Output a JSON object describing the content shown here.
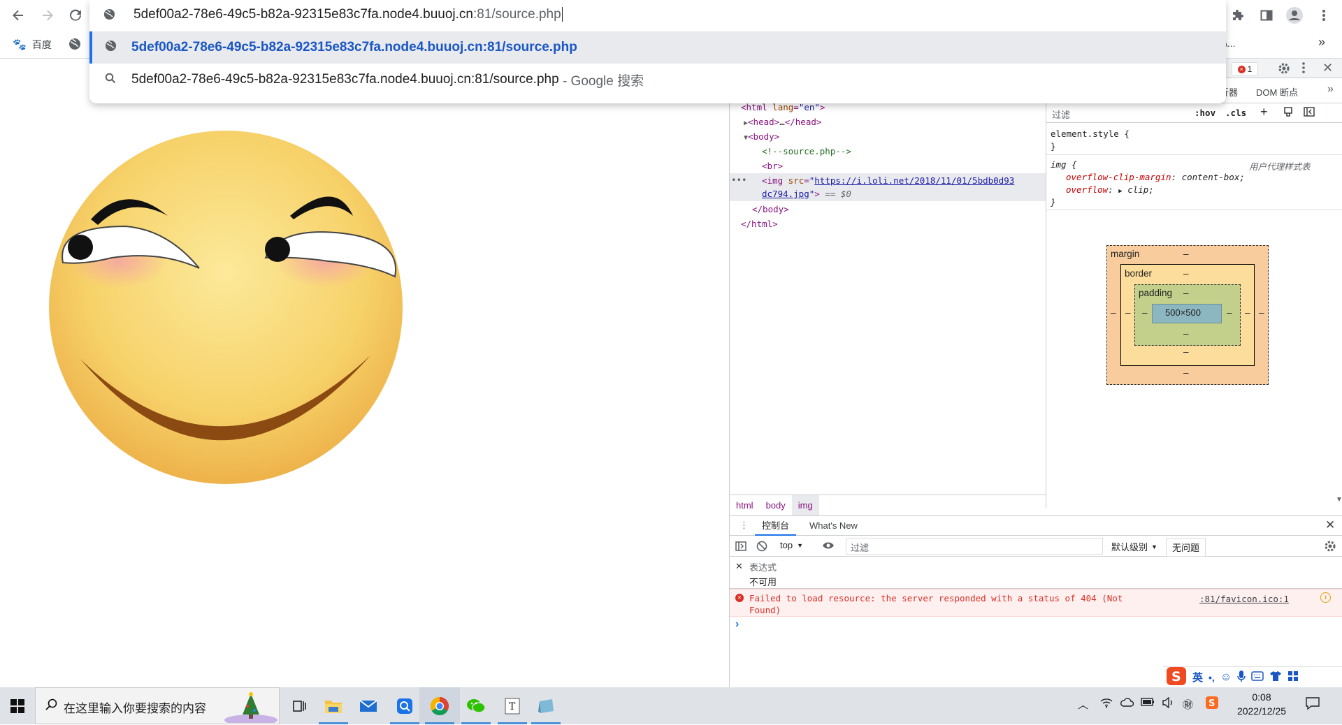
{
  "browser": {
    "url": "5def00a2-78e6-49c5-b82a-92315e83c7fa.node4.buuoj.cn:81/source.php",
    "url_host_part": "5def00a2-78e6-49c5-b82a-92315e83c7fa.node4.buuoj.cn",
    "url_rest_part": ":81/source.php",
    "suggestions": [
      {
        "icon": "globe-icon",
        "text": "5def00a2-78e6-49c5-b82a-92315e83c7fa.node4.buuoj.cn:81/source.php",
        "suffix": ""
      },
      {
        "icon": "search-icon",
        "text": "5def00a2-78e6-49c5-b82a-92315e83c7fa.node4.buuoj.cn:81/source.php",
        "suffix": " - Google 搜索"
      }
    ],
    "bookmarks": [
      {
        "label": "百度"
      }
    ],
    "bookmarks_overflow": "\\...",
    "chevron": "»"
  },
  "devtools": {
    "error_count": "1",
    "tab_partial": "沂器",
    "tab_dom": "DOM 断点",
    "more_tabs": "»",
    "elements": {
      "html_open": "<html lang=\"en\">",
      "lines": [
        {
          "indent": 0,
          "text": "<html lang=\"en\">"
        },
        {
          "indent": 1,
          "text": "▶<head>…</head>"
        },
        {
          "indent": 1,
          "text": "▼<body>"
        },
        {
          "indent": 2,
          "text": "<!--source.php-->"
        },
        {
          "indent": 2,
          "text": "<br>"
        }
      ],
      "img_src_1": "https://i.loli.net/2018/11/01/5bdb0d93",
      "img_src_2": "dc794.jpg",
      "img_eq": "== $0",
      "body_close": "</body>",
      "html_close": "</html>"
    },
    "breadcrumbs": [
      "html",
      "body",
      "img"
    ],
    "styles": {
      "filter_placeholder": "过滤",
      "hov": ":hov",
      "cls": ".cls",
      "element_style": "element.style {",
      "close_brace": "}",
      "img_selector": "img {",
      "ua_label": "用户代理样式表",
      "prop1_name": "overflow-clip-margin",
      "prop1_value": "content-box;",
      "prop2_name": "overflow",
      "prop2_value": "clip;"
    },
    "box_model": {
      "margin_label": "margin",
      "border_label": "border",
      "padding_label": "padding",
      "content_size": "500×500",
      "dash": "–"
    },
    "drawer": {
      "tabs": [
        "控制台",
        "What's New"
      ],
      "context": "top",
      "filter_placeholder": "过滤",
      "levels": "默认级别",
      "issues": "无问题",
      "expression_label": "表达式",
      "expression_value": "不可用",
      "error_message_1": "Failed to load resource: the server responded with a status of 404 (Not",
      "error_message_2": "Found)",
      "error_source": ":81/favicon.ico:1",
      "prompt": "›"
    }
  },
  "taskbar": {
    "search_placeholder": "在这里输入你要搜索的内容",
    "time": "0:08",
    "date": "2022/12/25",
    "ime_lang": "英",
    "ime_symbol": "•,"
  },
  "colors": {
    "accent": "#1a73e8",
    "error": "#d93025",
    "taskbar": "#dfe3e8"
  }
}
